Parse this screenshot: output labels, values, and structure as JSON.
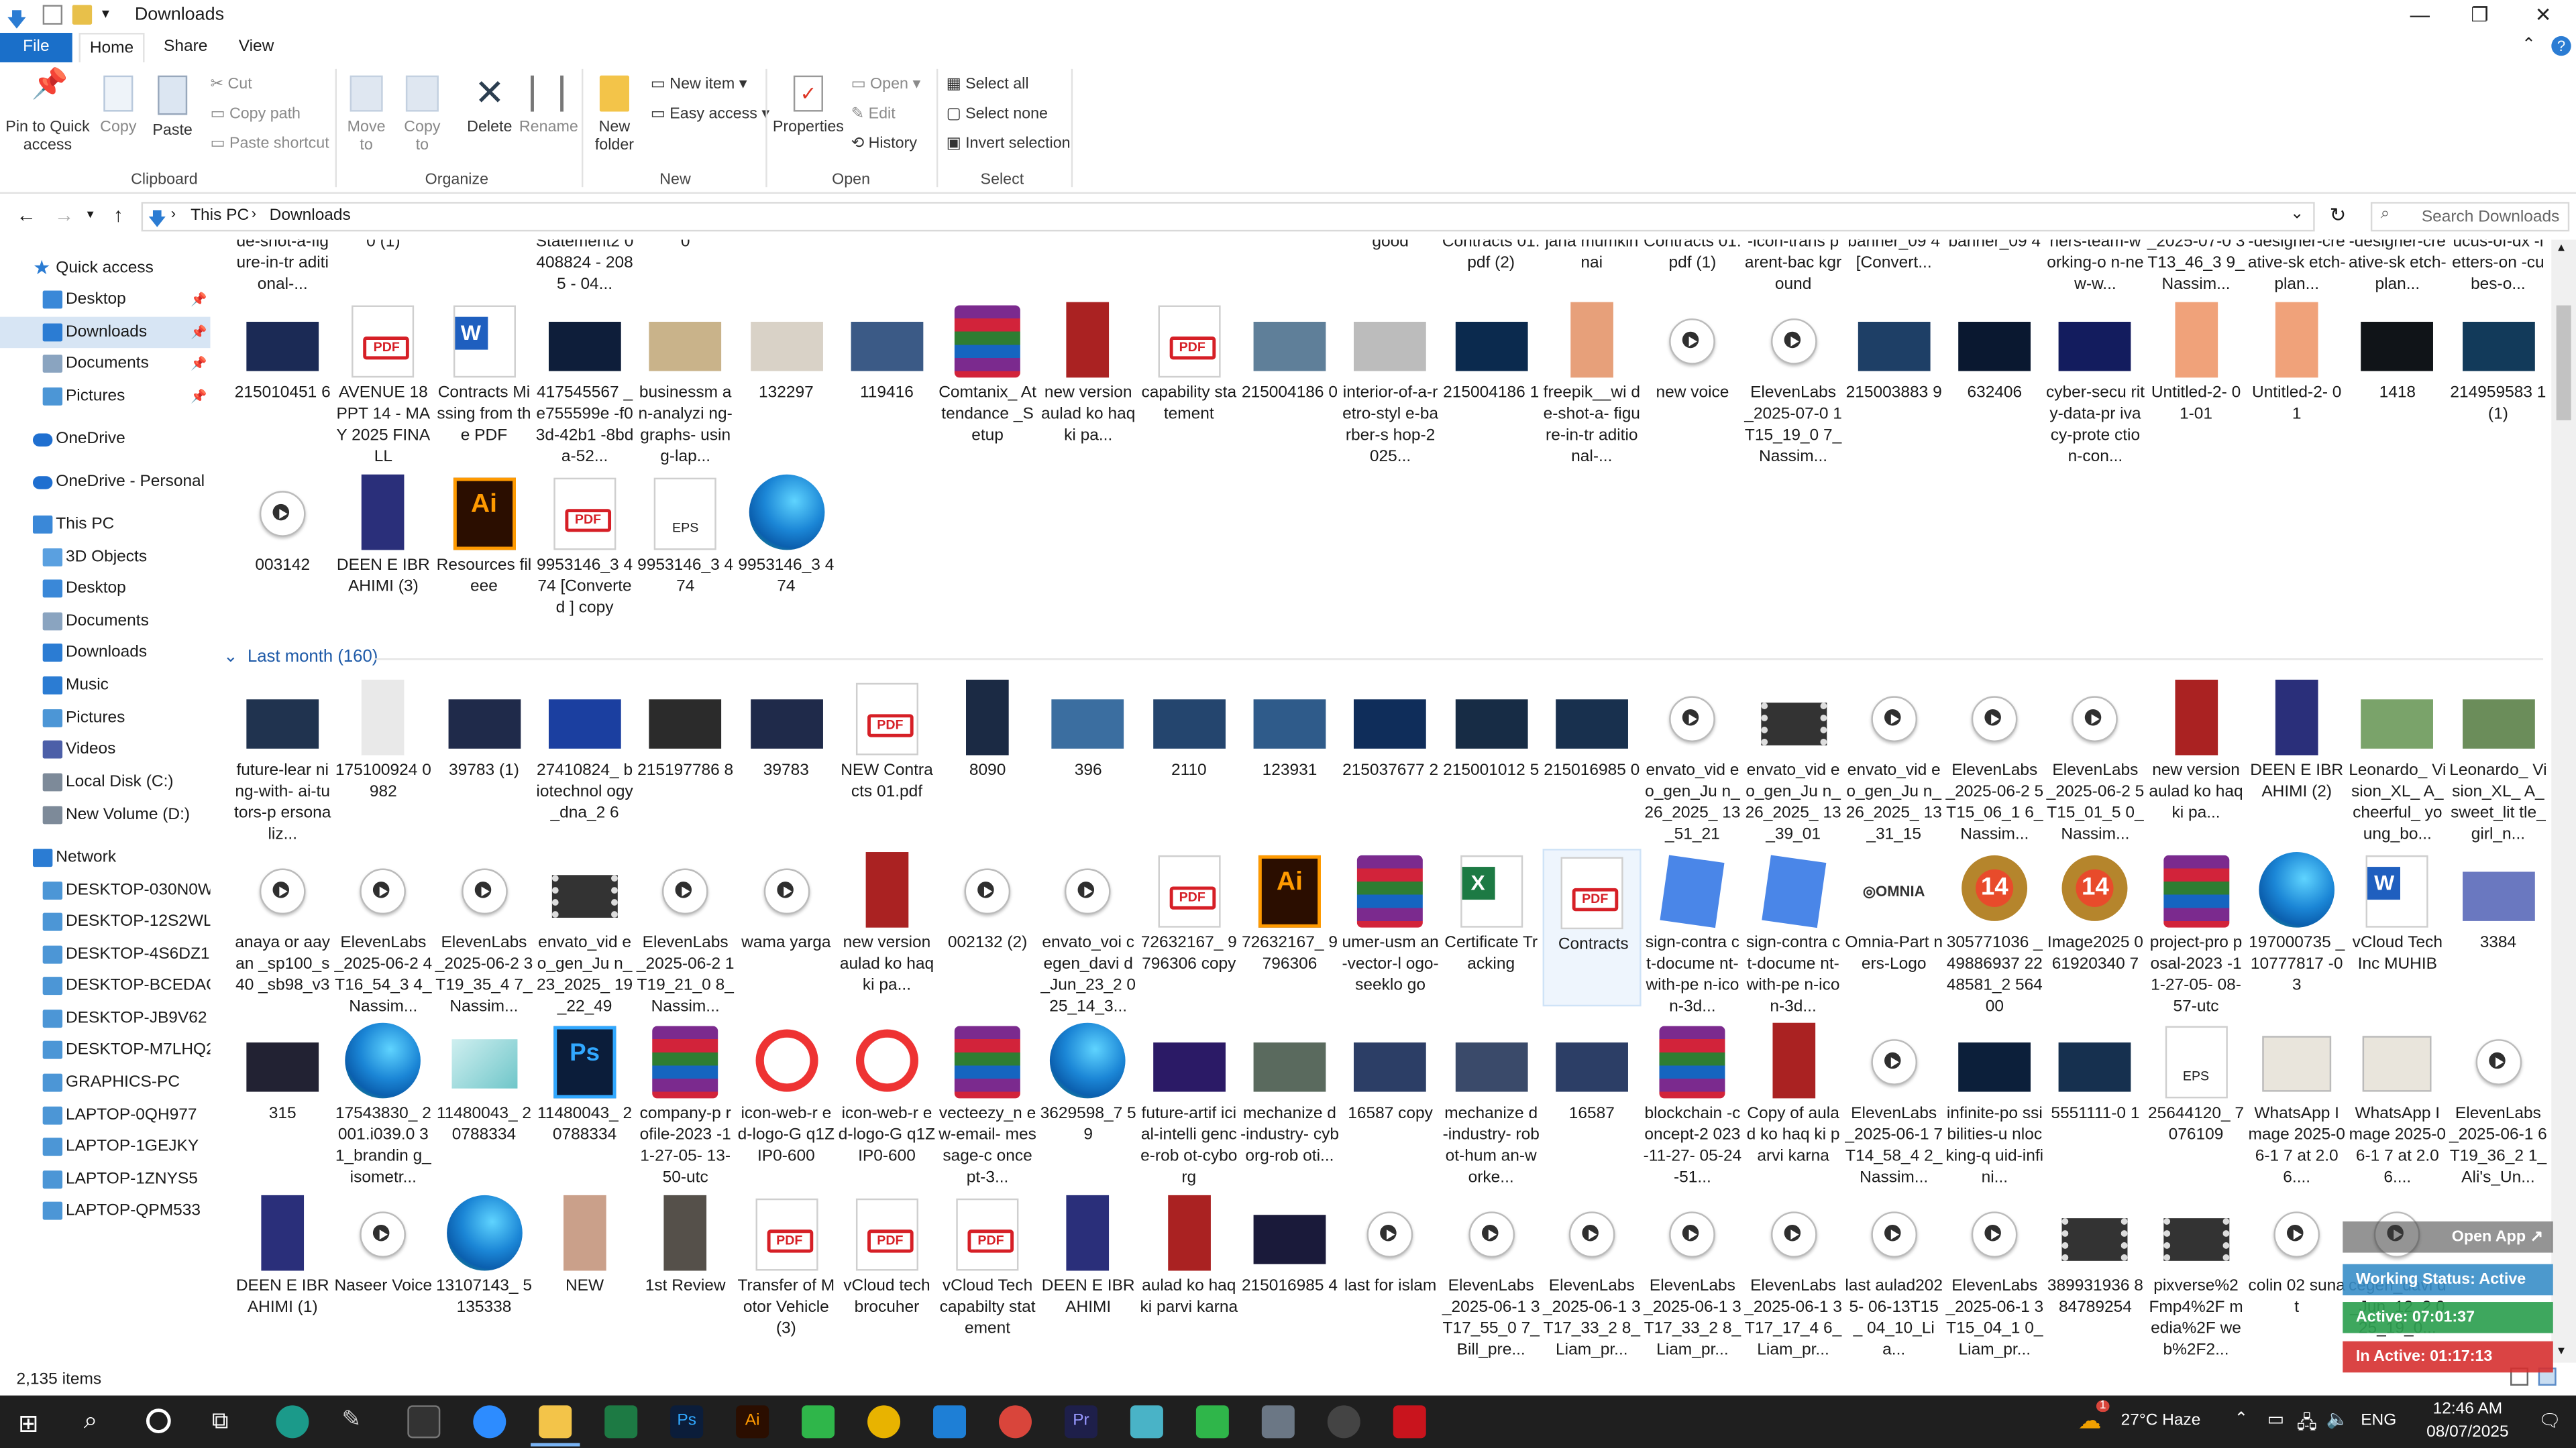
{
  "window": {
    "title": "Downloads"
  },
  "tabs": [
    {
      "label": "File"
    },
    {
      "label": "Home"
    },
    {
      "label": "Share"
    },
    {
      "label": "View"
    }
  ],
  "ribbon": {
    "pin_label": "Pin to Quick access",
    "copy": "Copy",
    "paste": "Paste",
    "cut": "Cut",
    "copy_path": "Copy path",
    "paste_shortcut": "Paste shortcut",
    "move_to": "Move to",
    "copy_to": "Copy to",
    "delete": "Delete",
    "rename": "Rename",
    "new_folder": "New folder",
    "new_item": "New item",
    "easy_access": "Easy access",
    "properties": "Properties",
    "open": "Open",
    "edit": "Edit",
    "history": "History",
    "select_all": "Select all",
    "select_none": "Select none",
    "invert_selection": "Invert selection",
    "groups": {
      "clipboard": "Clipboard",
      "organize": "Organize",
      "new": "New",
      "open": "Open",
      "select": "Select"
    }
  },
  "address": {
    "crumb1": "This PC",
    "crumb2": "Downloads",
    "search_placeholder": "Search Downloads"
  },
  "nav": [
    {
      "label": "Quick access",
      "icon": "star-icon",
      "color": "#2b7cd3"
    },
    {
      "label": "Desktop",
      "icon": "desktop-icon",
      "color": "#3a88d8",
      "pinned": true
    },
    {
      "label": "Downloads",
      "icon": "downloads-icon",
      "color": "#2b7cd3",
      "pinned": true,
      "selected": true
    },
    {
      "label": "Documents",
      "icon": "documents-icon",
      "color": "#8aa4c0",
      "pinned": true
    },
    {
      "label": "Pictures",
      "icon": "pictures-icon",
      "color": "#4c96d6",
      "pinned": true
    },
    {
      "label": "OneDrive",
      "icon": "cloud-icon",
      "color": "#1f6fd0"
    },
    {
      "label": "OneDrive - Personal",
      "icon": "cloud-icon",
      "color": "#1f6fd0"
    },
    {
      "label": "This PC",
      "icon": "computer-icon",
      "color": "#3a88d8"
    },
    {
      "label": "3D Objects",
      "icon": "cube-icon",
      "color": "#5aa0e0"
    },
    {
      "label": "Desktop",
      "icon": "desktop-icon",
      "color": "#3a88d8"
    },
    {
      "label": "Documents",
      "icon": "documents-icon",
      "color": "#8aa4c0"
    },
    {
      "label": "Downloads",
      "icon": "downloads-icon",
      "color": "#2b7cd3"
    },
    {
      "label": "Music",
      "icon": "music-icon",
      "color": "#2b7cd3"
    },
    {
      "label": "Pictures",
      "icon": "pictures-icon",
      "color": "#4c96d6"
    },
    {
      "label": "Videos",
      "icon": "videos-icon",
      "color": "#4c5fa8"
    },
    {
      "label": "Local Disk (C:)",
      "icon": "drive-icon",
      "color": "#7d8a99"
    },
    {
      "label": "New Volume (D:)",
      "icon": "drive-icon",
      "color": "#7d8a99"
    },
    {
      "label": "Network",
      "icon": "network-icon",
      "color": "#2b7cd3"
    },
    {
      "label": "DESKTOP-030N0W",
      "icon": "pc-icon",
      "color": "#4c96d6"
    },
    {
      "label": "DESKTOP-12S2WL",
      "icon": "pc-icon",
      "color": "#4c96d6"
    },
    {
      "label": "DESKTOP-4S6DZ1",
      "icon": "pc-icon",
      "color": "#4c96d6"
    },
    {
      "label": "DESKTOP-BCEDAOC",
      "icon": "pc-icon",
      "color": "#4c96d6"
    },
    {
      "label": "DESKTOP-JB9V62",
      "icon": "pc-icon",
      "color": "#4c96d6"
    },
    {
      "label": "DESKTOP-M7LHQ2",
      "icon": "pc-icon",
      "color": "#4c96d6"
    },
    {
      "label": "GRAPHICS-PC",
      "icon": "pc-icon",
      "color": "#4c96d6"
    },
    {
      "label": "LAPTOP-0QH977",
      "icon": "pc-icon",
      "color": "#4c96d6"
    },
    {
      "label": "LAPTOP-1GEJKY",
      "icon": "pc-icon",
      "color": "#4c96d6"
    },
    {
      "label": "LAPTOP-1ZNYS5",
      "icon": "pc-icon",
      "color": "#4c96d6"
    },
    {
      "label": "LAPTOP-QPM533",
      "icon": "pc-icon",
      "color": "#4c96d6"
    }
  ],
  "group_header": "Last month (160)",
  "rows": [
    [
      "de-shot-a-figure-in-tr aditional-...",
      "0 (1)",
      "",
      "Statement2 0408824 - 2085 - 04...",
      "0",
      "",
      "",
      "",
      "",
      "",
      "",
      "good",
      "Contracts 01.pdf (2)",
      "jana mumkin nai",
      "Contracts 01.pdf (1)",
      "-icon-trans parent-bac kground",
      "banner_09 4 [Convert...",
      "banner_09 4",
      "ners-team-working-o n-new-w...",
      "_2025-07-0 3T13_46_3 9_Nassim...",
      "-designer-creative-sk etch-plan...",
      "-designer-creative-sk etch-plan...",
      "ucus-of-dx -letters-on -cubes-o..."
    ],
    [
      {
        "n": "215010451 6",
        "t": "image",
        "c": "#1b2a55"
      },
      {
        "n": "AVENUE 18 PPT 14 - MAY 2025 FINALL",
        "t": "pdf"
      },
      {
        "n": "Contracts Missing from the PDF",
        "t": "word"
      },
      {
        "n": "417545567 _e755599e -f03d-42b1 -8bda-52...",
        "t": "image",
        "c": "#0e1e3a"
      },
      {
        "n": "businessm an-analyzi ng-graphs- using-lap...",
        "t": "image",
        "c": "#c9b38a"
      },
      {
        "n": "132297",
        "t": "image",
        "c": "#d9d2c7"
      },
      {
        "n": "119416",
        "t": "image",
        "c": "#3b5a86"
      },
      {
        "n": "Comtanix_ Attendance _Setup",
        "t": "rar"
      },
      {
        "n": "new version aulad ko haq ki pa...",
        "t": "tall",
        "c": "#a22"
      },
      {
        "n": "capability statement",
        "t": "pdf"
      },
      {
        "n": "215004186 0",
        "t": "image",
        "c": "#5f7f99"
      },
      {
        "n": "interior-of-a-retro-styl e-barber-s hop-2025...",
        "t": "image",
        "c": "#bcbcbc"
      },
      {
        "n": "215004186 1",
        "t": "image",
        "c": "#0b2a4e"
      },
      {
        "n": "freepik__wi de-shot-a- figure-in-tr aditional-...",
        "t": "tall",
        "c": "#e7a07a"
      },
      {
        "n": "new voice",
        "t": "audio"
      },
      {
        "n": "ElevenLabs _2025-07-0 1T15_19_0 7_Nassim...",
        "t": "audio"
      },
      {
        "n": "215003883 9",
        "t": "image",
        "c": "#1e3f66"
      },
      {
        "n": "632406",
        "t": "image",
        "c": "#0a1830"
      },
      {
        "n": "cyber-secu rity-data-pr ivacy-prote ction-con...",
        "t": "image",
        "c": "#131c5e"
      },
      {
        "n": "Untitled-2- 01-01",
        "t": "tall",
        "c": "#f0a27a"
      },
      {
        "n": "Untitled-2- 01",
        "t": "tall",
        "c": "#f0a27a"
      },
      {
        "n": "1418",
        "t": "image",
        "c": "#101418"
      },
      {
        "n": "214959583 1 (1)",
        "t": "image",
        "c": "#123a5a"
      }
    ],
    [
      {
        "n": "003142",
        "t": "audio"
      },
      {
        "n": "DEEN E IBRAHIMI (3)",
        "t": "tall",
        "c": "#2a2f7a"
      },
      {
        "n": "Resources fileee",
        "t": "ai"
      },
      {
        "n": "9953146_3 474 [Converted ] copy",
        "t": "pdf"
      },
      {
        "n": "9953146_3 474",
        "t": "eps"
      },
      {
        "n": "9953146_3 474",
        "t": "edge"
      }
    ],
    [
      {
        "n": "future-lear ning-with- ai-tutors-p ersonaliz...",
        "t": "image",
        "c": "#20334f"
      },
      {
        "n": "175100924 0982",
        "t": "tall",
        "c": "#e9e9e9"
      },
      {
        "n": "39783 (1)",
        "t": "image",
        "c": "#1f2a4a"
      },
      {
        "n": "27410824_ biotechnol ogy_dna_2 6",
        "t": "image",
        "c": "#1b3fa0"
      },
      {
        "n": "215197786 8",
        "t": "image",
        "c": "#2b2b2b"
      },
      {
        "n": "39783",
        "t": "image",
        "c": "#1f2a4a"
      },
      {
        "n": "NEW Contracts 01.pdf",
        "t": "pdf"
      },
      {
        "n": "8090",
        "t": "tall",
        "c": "#1b2a44"
      },
      {
        "n": "396",
        "t": "image",
        "c": "#3b6ea0"
      },
      {
        "n": "2110",
        "t": "image",
        "c": "#24456e"
      },
      {
        "n": "123931",
        "t": "image",
        "c": "#2f5b8a"
      },
      {
        "n": "215037677 2",
        "t": "image",
        "c": "#0f2d5a"
      },
      {
        "n": "215001012 5",
        "t": "image",
        "c": "#172c45"
      },
      {
        "n": "215016985 0",
        "t": "image",
        "c": "#18304e"
      },
      {
        "n": "envato_vid eo_gen_Ju n_26_2025_ 13_51_21",
        "t": "audio"
      },
      {
        "n": "envato_vid eo_gen_Ju n_26_2025_ 13_39_01",
        "t": "film"
      },
      {
        "n": "envato_vid eo_gen_Ju n_26_2025_ 13_31_15",
        "t": "audio"
      },
      {
        "n": "ElevenLabs _2025-06-2 5T15_06_1 6_Nassim...",
        "t": "audio"
      },
      {
        "n": "ElevenLabs _2025-06-2 5T15_01_5 0_Nassim...",
        "t": "audio"
      },
      {
        "n": "new version aulad ko haq ki pa...",
        "t": "tall",
        "c": "#a22"
      },
      {
        "n": "DEEN E IBRAHIMI (2)",
        "t": "tall",
        "c": "#2a2f7a"
      },
      {
        "n": "Leonardo_ Vision_XL_ A_cheerful_ young_bo...",
        "t": "image",
        "c": "#7aa36a"
      },
      {
        "n": "Leonardo_ Vision_XL_ A_sweet_lit tle_girl_n...",
        "t": "image",
        "c": "#6b8d5a"
      }
    ],
    [
      {
        "n": "anaya or aayan _sp100_s40 _sb98_v3",
        "t": "audio"
      },
      {
        "n": "ElevenLabs _2025-06-2 4T16_54_3 4_Nassim...",
        "t": "audio"
      },
      {
        "n": "ElevenLabs _2025-06-2 3T19_35_4 7_Nassim...",
        "t": "audio"
      },
      {
        "n": "envato_vid eo_gen_Ju n_23_2025_ 19_22_49",
        "t": "film"
      },
      {
        "n": "ElevenLabs _2025-06-2 1T19_21_0 8_Nassim...",
        "t": "audio"
      },
      {
        "n": "wama yarga",
        "t": "audio"
      },
      {
        "n": "new version aulad ko haq ki pa...",
        "t": "tall",
        "c": "#a22"
      },
      {
        "n": "002132 (2)",
        "t": "audio"
      },
      {
        "n": "envato_voi cegen_davi d_Jun_23_2 025_14_3...",
        "t": "audio"
      },
      {
        "n": "72632167_ 9796306 copy",
        "t": "pdf"
      },
      {
        "n": "72632167_ 9796306",
        "t": "ai"
      },
      {
        "n": "umer-usm an-vector-l ogo-seeklo go",
        "t": "rar"
      },
      {
        "n": "Certificate Tracking",
        "t": "excel"
      },
      {
        "n": "Contracts",
        "t": "pdf",
        "sel": true
      },
      {
        "n": "sign-contra ct-docume nt-with-pe n-icon-3d...",
        "t": "sign"
      },
      {
        "n": "sign-contra ct-docume nt-with-pe n-icon-3d...",
        "t": "sign"
      },
      {
        "n": "Omnia-Part ners-Logo",
        "t": "omnia"
      },
      {
        "n": "305771036 _49886937 2248581_2 56400",
        "t": "badge"
      },
      {
        "n": "Image2025 061920340 7",
        "t": "badge"
      },
      {
        "n": "project-pro posal-2023 -11-27-05- 08-57-utc",
        "t": "rar"
      },
      {
        "n": "197000735 _10777817 -03",
        "t": "edge"
      },
      {
        "n": "vCloud Tech Inc MUHIB",
        "t": "word"
      },
      {
        "n": "3384",
        "t": "image",
        "c": "#6a78c0"
      }
    ],
    [
      {
        "n": "315",
        "t": "image",
        "c": "#223"
      },
      {
        "n": "17543830_ 2001.i039.0 31_brandin g_isometr...",
        "t": "edge"
      },
      {
        "n": "11480043_ 20788334",
        "t": "teal"
      },
      {
        "n": "11480043_ 20788334",
        "t": "psd"
      },
      {
        "n": "company-p rofile-2023 -11-27-05- 13-50-utc",
        "t": "rar"
      },
      {
        "n": "icon-web-r ed-logo-G q1ZIP0-600",
        "t": "redlogo"
      },
      {
        "n": "icon-web-r ed-logo-G q1ZIP0-600",
        "t": "redlogo"
      },
      {
        "n": "vecteezy_n ew-email- message-c oncept-3...",
        "t": "rar"
      },
      {
        "n": "3629598_7 59",
        "t": "edge"
      },
      {
        "n": "future-artif icial-intelli gence-rob ot-cyborg",
        "t": "image",
        "c": "#2b1a66"
      },
      {
        "n": "mechanize d-industry- cyborg-rob oti...",
        "t": "image",
        "c": "#5a6a5e"
      },
      {
        "n": "16587 copy",
        "t": "image",
        "c": "#2c3e66"
      },
      {
        "n": "mechanize d-industry- robot-hum an-worke...",
        "t": "image",
        "c": "#3a4a6a"
      },
      {
        "n": "16587",
        "t": "image",
        "c": "#2c3e66"
      },
      {
        "n": "blockchain -concept-2 023-11-27- 05-24-51...",
        "t": "rar"
      },
      {
        "n": "Copy of aulad ko haq ki parvi karna",
        "t": "tall",
        "c": "#a22"
      },
      {
        "n": "ElevenLabs _2025-06-1 7T14_58_4 2_Nassim...",
        "t": "audio"
      },
      {
        "n": "infinite-po ssibilities-u nlocking-q uid-infini...",
        "t": "image",
        "c": "#0c1f3a"
      },
      {
        "n": "5551111-0 1",
        "t": "image",
        "c": "#16304f"
      },
      {
        "n": "25644120_ 7076109",
        "t": "eps"
      },
      {
        "n": "WhatsApp Image 2025-06-1 7 at 2.06....",
        "t": "paper"
      },
      {
        "n": "WhatsApp Image 2025-06-1 7 at 2.06....",
        "t": "paper"
      },
      {
        "n": "ElevenLabs _2025-06-1 6T19_36_2 1_Ali's_Un...",
        "t": "audio"
      }
    ],
    [
      {
        "n": "DEEN E IBRAHIMI (1)",
        "t": "tall",
        "c": "#2a2f7a"
      },
      {
        "n": "Naseer Voice",
        "t": "audio"
      },
      {
        "n": "13107143_ 5135338",
        "t": "edge"
      },
      {
        "n": "NEW",
        "t": "tall",
        "c": "#caa08a"
      },
      {
        "n": "1st Review",
        "t": "tall",
        "c": "#55504a"
      },
      {
        "n": "Transfer of Motor Vehicle (3)",
        "t": "pdf"
      },
      {
        "n": "vCloud tech brocuher",
        "t": "pdf"
      },
      {
        "n": "vCloud Tech capabilty statement",
        "t": "pdf"
      },
      {
        "n": "DEEN E IBRAHIMI",
        "t": "tall",
        "c": "#2a2f7a"
      },
      {
        "n": "aulad ko haq ki parvi karna",
        "t": "tall",
        "c": "#a22"
      },
      {
        "n": "215016985 4",
        "t": "image",
        "c": "#1a1a3a"
      },
      {
        "n": "last for islam",
        "t": "audio"
      },
      {
        "n": "ElevenLabs _2025-06-1 3T17_55_0 7_Bill_pre...",
        "t": "audio"
      },
      {
        "n": "ElevenLabs _2025-06-1 3T17_33_2 8_Liam_pr...",
        "t": "audio"
      },
      {
        "n": "ElevenLabs _2025-06-1 3T17_33_2 8_Liam_pr...",
        "t": "audio"
      },
      {
        "n": "ElevenLabs _2025-06-1 3T17_17_4 6_Liam_pr...",
        "t": "audio"
      },
      {
        "n": "last aulad2025- 06-13T15_ 04_10_Lia...",
        "t": "audio"
      },
      {
        "n": "ElevenLabs _2025-06-1 3T15_04_1 0_Liam_pr...",
        "t": "audio"
      },
      {
        "n": "389931936 884789254",
        "t": "film"
      },
      {
        "n": "pixverse%2 Fmp4%2F media%2F web%2F2...",
        "t": "film"
      },
      {
        "n": "colin 02 sunat",
        "t": "audio"
      },
      {
        "n": "cegen_davi d_Jun_12_2 025_19_0...",
        "t": "audio"
      },
      {
        "n": "",
        "t": "none"
      }
    ]
  ],
  "status": {
    "count": "2,135 items"
  },
  "overlay": {
    "open_app": "Open App ↗",
    "working": "Working Status: Active",
    "active": "Active: 07:01:37",
    "inactive": "In Active: 01:17:13"
  },
  "taskbar": {
    "weather": "27°C Haze",
    "lang": "ENG",
    "time": "12:46 AM",
    "date": "08/07/2025",
    "badge": "1"
  }
}
